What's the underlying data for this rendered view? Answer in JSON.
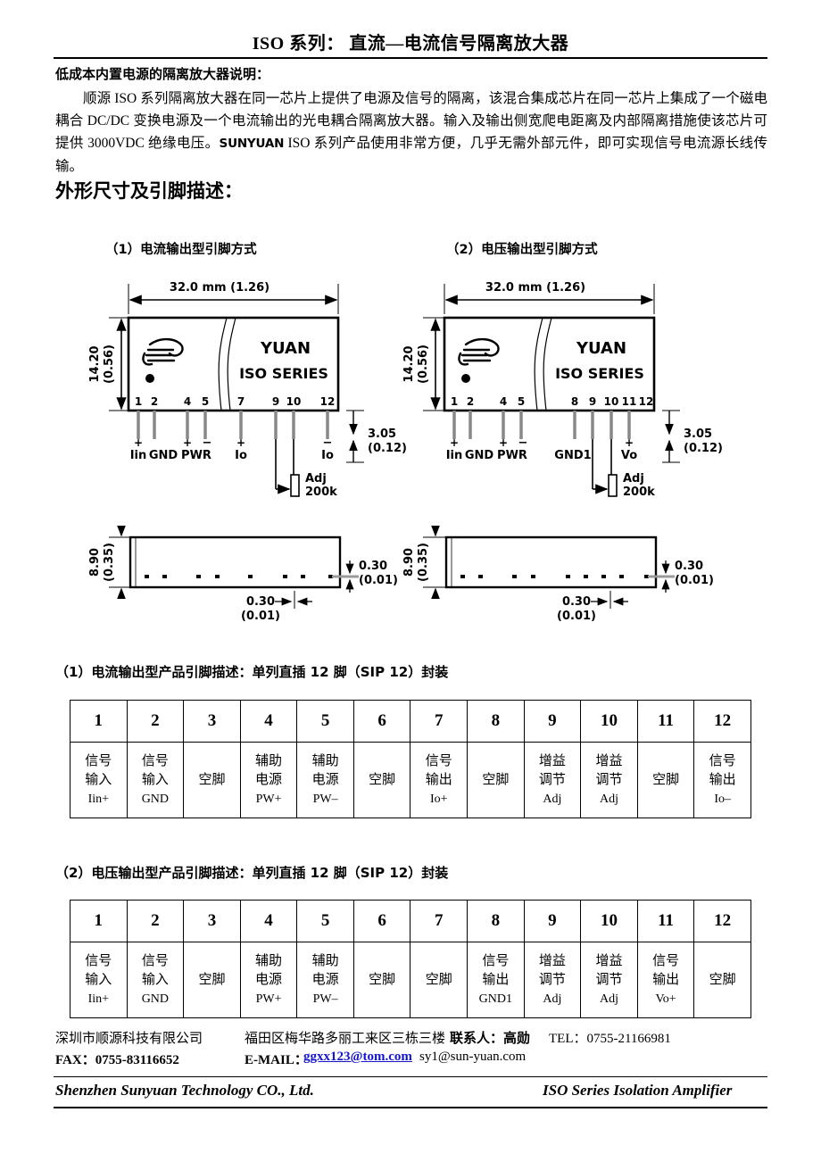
{
  "header": {
    "title": "ISO 系列：  直流—电流信号隔离放大器"
  },
  "intro": {
    "heading": "低成本内置电源的隔离放大器说明：",
    "body_part1": "顺源 ISO 系列隔离放大器在同一芯片上提供了电源及信号的隔离，该混合集成芯片在同一芯片上集成了一个磁电耦合 DC/DC 变换电源及一个电流输出的光电耦合隔离放大器。输入及输出侧宽爬电距离及内部隔离措施使该芯片可提供 3000VDC 绝缘电压。",
    "brand": "SUNYUAN",
    "body_part2": " ISO 系列产品使用非常方便，几乎无需外部元件，即可实现信号电流源长线传输。"
  },
  "section": {
    "heading": "外形尺寸及引脚描述："
  },
  "diagrams": {
    "left": {
      "caption": "（1）电流输出型引脚方式",
      "width_dim": "32.0 mm (1.26)",
      "height_dim_mm": "14.20",
      "height_dim_in": "(0.56)",
      "pin_height_mm": "3.05",
      "pin_height_in": "(0.12)",
      "body_text_1": "YUAN",
      "body_text_2": "ISO  SERIES",
      "pin_numbers": [
        "1",
        "2",
        "4",
        "5",
        "7",
        "9",
        "10",
        "12"
      ],
      "pin_labels": [
        "Iin",
        "GND",
        "PWR",
        "Io",
        "Io"
      ],
      "adj_label_1": "Adj",
      "adj_label_2": "200k",
      "bottom_view": {
        "height_mm": "8.90",
        "height_in": "(0.35)",
        "lead_w_mm": "0.30",
        "lead_w_in": "(0.01)",
        "lead_t_mm": "0.30",
        "lead_t_in": "(0.01)"
      }
    },
    "right": {
      "caption": "（2）电压输出型引脚方式",
      "width_dim": "32.0 mm  (1.26)",
      "height_dim_mm": "14.20",
      "height_dim_in": "(0.56)",
      "pin_height_mm": "3.05",
      "pin_height_in": "(0.12)",
      "body_text_1": "YUAN",
      "body_text_2": "ISO  SERIES",
      "pin_numbers": [
        "1",
        "2",
        "4",
        "5",
        "8",
        "9",
        "10",
        "11",
        "12"
      ],
      "pin_labels": [
        "Iin",
        "GND",
        "PWR",
        "GND1",
        "Vo"
      ],
      "adj_label_1": "Adj",
      "adj_label_2": "200k",
      "bottom_view": {
        "height_mm": "8.90",
        "height_in": "(0.35)",
        "lead_w_mm": "0.30",
        "lead_w_in": "(0.01)",
        "lead_t_mm": "0.30",
        "lead_t_in": "(0.01)"
      }
    }
  },
  "table1": {
    "caption": "（1）电流输出型产品引脚描述：单列直插 12 脚（SIP 12）封装",
    "headers": [
      "1",
      "2",
      "3",
      "4",
      "5",
      "6",
      "7",
      "8",
      "9",
      "10",
      "11",
      "12"
    ],
    "cells": [
      {
        "l1": "信号",
        "l2": "输入",
        "l3": "Iin+"
      },
      {
        "l1": "信号",
        "l2": "输入",
        "l3": "GND"
      },
      {
        "l1": "",
        "l2": "空脚",
        "l3": ""
      },
      {
        "l1": "辅助",
        "l2": "电源",
        "l3": "PW+"
      },
      {
        "l1": "辅助",
        "l2": "电源",
        "l3": "PW–"
      },
      {
        "l1": "",
        "l2": "空脚",
        "l3": ""
      },
      {
        "l1": "信号",
        "l2": "输出",
        "l3": "Io+"
      },
      {
        "l1": "",
        "l2": "空脚",
        "l3": ""
      },
      {
        "l1": "增益",
        "l2": "调节",
        "l3": "Adj"
      },
      {
        "l1": "增益",
        "l2": "调节",
        "l3": "Adj"
      },
      {
        "l1": "",
        "l2": "空脚",
        "l3": ""
      },
      {
        "l1": "信号",
        "l2": "输出",
        "l3": "Io–"
      }
    ]
  },
  "table2": {
    "caption": "（2）电压输出型产品引脚描述：单列直插 12 脚（SIP 12）封装",
    "headers": [
      "1",
      "2",
      "3",
      "4",
      "5",
      "6",
      "7",
      "8",
      "9",
      "10",
      "11",
      "12"
    ],
    "cells": [
      {
        "l1": "信号",
        "l2": "输入",
        "l3": "Iin+"
      },
      {
        "l1": "信号",
        "l2": "输入",
        "l3": "GND"
      },
      {
        "l1": "",
        "l2": "空脚",
        "l3": ""
      },
      {
        "l1": "辅助",
        "l2": "电源",
        "l3": "PW+"
      },
      {
        "l1": "辅助",
        "l2": "电源",
        "l3": "PW–"
      },
      {
        "l1": "",
        "l2": "空脚",
        "l3": ""
      },
      {
        "l1": "",
        "l2": "空脚",
        "l3": ""
      },
      {
        "l1": "信号",
        "l2": "输出",
        "l3": "GND1"
      },
      {
        "l1": "增益",
        "l2": "调节",
        "l3": "Adj"
      },
      {
        "l1": "增益",
        "l2": "调节",
        "l3": "Adj"
      },
      {
        "l1": "信号",
        "l2": "输出",
        "l3": "Vo+"
      },
      {
        "l1": "",
        "l2": "空脚",
        "l3": ""
      }
    ]
  },
  "contact": {
    "company": "深圳市顺源科技有限公司",
    "address": "福田区梅华路多丽工来区三栋三楼",
    "person": "联系人：高勋",
    "tel": "TEL：0755-21166981",
    "fax": "FAX：0755-83116652",
    "email_label": "E-MAIL：",
    "email_link": "ggxx123@tom.com",
    "email_alt": "sy1@sun-yuan.com"
  },
  "footer": {
    "left": "Shenzhen  Sunyuan  Technology  CO.,  Ltd.",
    "right": "ISO Series   Isolation Amplifier"
  }
}
